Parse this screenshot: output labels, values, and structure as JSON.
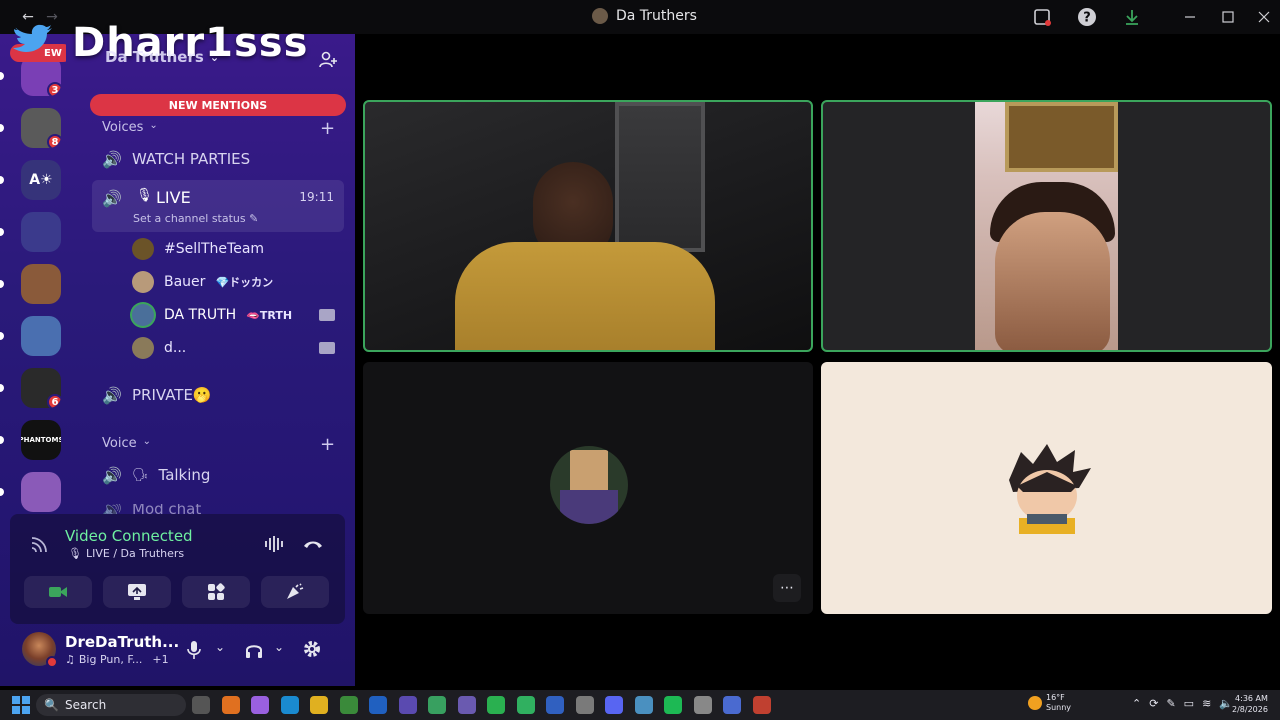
{
  "window": {
    "title": "Da Truthers",
    "controls": [
      "minimize-icon",
      "maximize-icon",
      "close-icon"
    ],
    "tools": [
      "inbox-icon",
      "help-icon",
      "download-icon"
    ]
  },
  "overlay": {
    "watermark_text": "Dharr1sss",
    "bird_label": "EW"
  },
  "server_header": {
    "name": "Da Truthers"
  },
  "servers": [
    {
      "name": "server-1",
      "badge": "3",
      "color": "#7a3fb5"
    },
    {
      "name": "server-2",
      "badge": "8",
      "color": "#5a5a5a"
    },
    {
      "name": "server-3",
      "label": "A☀",
      "badge": "",
      "color": "#36337a"
    },
    {
      "name": "server-4",
      "badge": "",
      "color": "#3b3a8c"
    },
    {
      "name": "server-5",
      "badge": "",
      "color": "#8a5a3a"
    },
    {
      "name": "server-6",
      "badge": "",
      "color": "#4a6fb0"
    },
    {
      "name": "server-7",
      "badge": "6",
      "color": "#2a2a2a"
    },
    {
      "name": "server-8",
      "label": "PHANTOMS",
      "badge": "",
      "color": "#111111"
    },
    {
      "name": "server-9",
      "badge": "",
      "color": "#8a5ab8"
    }
  ],
  "mentions_banner": "NEW MENTIONS",
  "categories": {
    "voices": "Voices",
    "voice": "Voice"
  },
  "channels": {
    "watch_parties": "WATCH PARTIES",
    "live": "LIVE",
    "live_time": "19:11",
    "live_status": "Set a channel status",
    "private": "PRIVATE🫢",
    "talking": "Talking",
    "mod_chat": "Mod chat"
  },
  "voice_users": [
    {
      "name": "#SellTheTeam",
      "tag": "",
      "camera": false,
      "color": "#6b5328"
    },
    {
      "name": "Bauer",
      "tag": "💎ドッカン",
      "camera": false,
      "color": "#b89a7a"
    },
    {
      "name": "DA TRUTH",
      "tag": "🫦TRTH",
      "camera": true,
      "color": "#4a6f9a"
    },
    {
      "name": "d...",
      "tag": "",
      "camera": true,
      "color": "#8a7a5a"
    }
  ],
  "voice_panel": {
    "status": "Video Connected",
    "channel": "LIVE / Da Truthers",
    "buttons": [
      "camera-icon",
      "screen-share-icon",
      "activities-icon",
      "soundboard-icon"
    ]
  },
  "user": {
    "name": "DreDaTruth...",
    "activity": "Big Pun, F...",
    "extra": "+1"
  },
  "taskbar": {
    "search_placeholder": "Search",
    "weather_temp": "16°F",
    "weather_desc": "Sunny",
    "time": "4:36 AM",
    "date": "2/8/2026"
  },
  "colors": {
    "mention_red": "#dc3545",
    "speaking_green": "#3ba55c",
    "tile_bg": "#121214",
    "tile_light": "#f3e8dc"
  }
}
